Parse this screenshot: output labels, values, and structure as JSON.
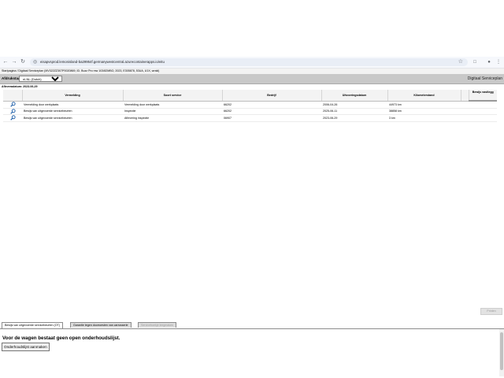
{
  "browser": {
    "url": "eisapvsprod.lemonisland-ba29954f.germanywestcentral.azurecontainerapps.io/eitu"
  },
  "app": {
    "breadcrumb": "Startpagina / Digitaal Serviceplan (MV322ZZ307P0020869, ID. Buzz Pro mw 103/82MBO, 2023, E305878, 53UA, U1X, wraki)",
    "language_label": "Afdrukstaal:",
    "language_value": "nl-NL (Dutch)",
    "app_title": "Digitaal Serviceplan",
    "date_line": "Afleveradatum: 2023-06-29"
  },
  "table": {
    "columns": [
      "",
      "Vermelding",
      "Soort service",
      "Bedrijf",
      "Uitvoeringsdatum",
      "Kilometerstand",
      "",
      "Bewijs vastlegg"
    ],
    "rows": [
      {
        "vermelding": "Vermelding door werkplaats",
        "soort": "Vermelding door werkplaats",
        "bedrijf": "66202",
        "datum": "2006-04-26",
        "km": "44973 km"
      },
      {
        "vermelding": "Bewijs van uitgevoerde servicebeurten",
        "soort": "Inspectie",
        "bedrijf": "66202",
        "datum": "2025-06-11",
        "km": "38858 km"
      },
      {
        "vermelding": "Bewijs van uitgevoerde servicebeurten",
        "soort": "Aflevering inspectie",
        "bedrijf": "06907",
        "datum": "2023-06-29",
        "km": "3 km"
      }
    ]
  },
  "disabled_button_label": "Printen",
  "tabs": [
    {
      "label": "Bewijs van uitgevoerde servicebeurten (OT)"
    },
    {
      "label": "Garantie tegen doorroesten van carrosserie"
    },
    {
      "label": "Serviceboekje leegmaken"
    }
  ],
  "panel": {
    "message": "Voor de wagen bestaat geen open onderhoudslijst.",
    "button_label": "Onderhoudslijst aanmaken"
  }
}
